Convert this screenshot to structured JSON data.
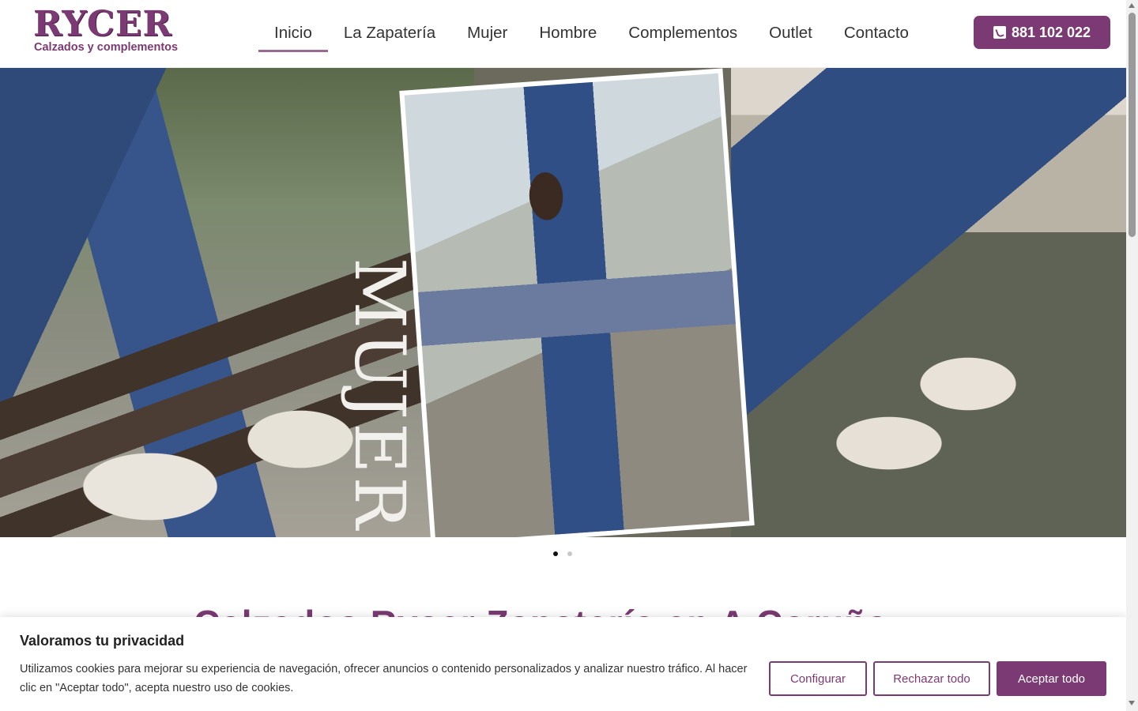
{
  "brand": {
    "name": "RYCER",
    "tagline": "Calzados y complementos",
    "color": "#7b3a73"
  },
  "nav": {
    "items": [
      {
        "label": "Inicio",
        "active": true
      },
      {
        "label": "La Zapatería",
        "active": false
      },
      {
        "label": "Mujer",
        "active": false
      },
      {
        "label": "Hombre",
        "active": false
      },
      {
        "label": "Complementos",
        "active": false
      },
      {
        "label": "Outlet",
        "active": false
      },
      {
        "label": "Contacto",
        "active": false
      }
    ]
  },
  "phone": {
    "label": "881 102 022",
    "icon": "phone-icon"
  },
  "hero": {
    "overlay_word": "MUJER",
    "slides_total": 2,
    "active_slide": 1
  },
  "page": {
    "heading": "Calzados Ryser Zapatería en A Coruña"
  },
  "cookie_banner": {
    "title": "Valoramos tu privacidad",
    "text": "Utilizamos cookies para mejorar su experiencia de navegación, ofrecer anuncios o contenido personalizados y analizar nuestro tráfico. Al hacer clic en \"Aceptar todo\", acepta nuestro uso de cookies.",
    "buttons": {
      "configure": "Configurar",
      "reject": "Rechazar todo",
      "accept": "Aceptar todo"
    }
  }
}
